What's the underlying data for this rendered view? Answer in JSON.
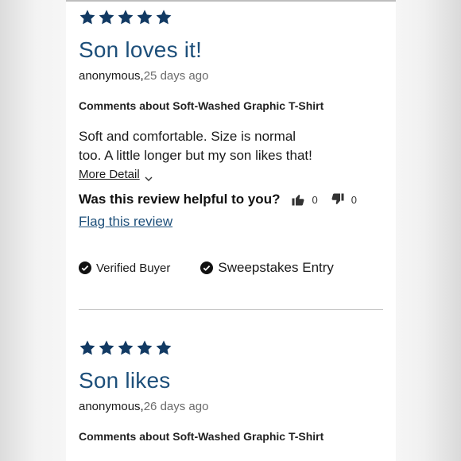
{
  "reviews": [
    {
      "rating": 5,
      "title": "Son loves it!",
      "author": "anonymous,",
      "time_ago": "25 days ago",
      "comments_about": "Comments about Soft-Washed Graphic T-Shirt",
      "body": "Soft and comfortable. Size is normal too. A little longer but my son likes that!",
      "more_detail_label": "More Detail",
      "helpful_question": "Was this review helpful to you?",
      "helpful_yes": "0",
      "helpful_no": "0",
      "flag_label": "Flag this review",
      "badges": [
        "Verified Buyer",
        "Sweepstakes Entry"
      ]
    },
    {
      "rating": 5,
      "title": "Son likes",
      "author": "anonymous,",
      "time_ago": "26 days ago",
      "comments_about": "Comments about Soft-Washed Graphic T-Shirt"
    }
  ],
  "colors": {
    "accent": "#1d4f7a",
    "star": "#123a63"
  },
  "icons": {
    "star": "star-icon",
    "thumbs_up": "thumbs-up-icon",
    "thumbs_down": "thumbs-down-icon",
    "check": "check-circle-icon",
    "chevron": "chevron-down-icon"
  }
}
